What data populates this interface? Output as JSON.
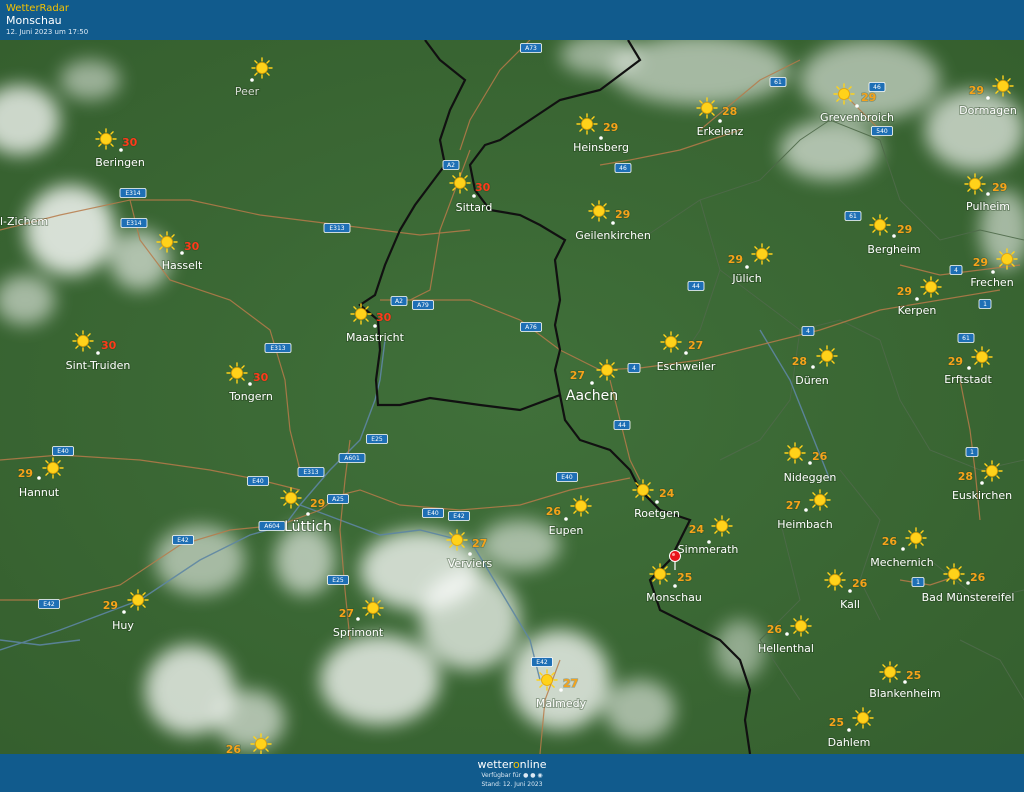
{
  "header": {
    "app_title": "WetterRadar",
    "location": "Monschau",
    "timestamp": "12. Juni 2023 um 17:50"
  },
  "footer": {
    "brand_a": "wetter",
    "brand_o": "o",
    "brand_b": "nline",
    "available": "Verfügbar für",
    "stand": "Stand: 12. Juni 2023"
  },
  "colors": {
    "land": "#3d6b35",
    "header_bg": "#115b8d",
    "brand_accent": "#f5c300",
    "temp_orange": "#f5a21a",
    "temp_red": "#ff3a1a",
    "sun": "#ffd21a"
  },
  "marker": {
    "name": "Monschau",
    "icon": "location-pin-icon"
  },
  "cities": [
    {
      "name": "Peer",
      "temp": null,
      "dim": true,
      "icon": "sun-icon"
    },
    {
      "name": "Beringen",
      "temp": "30",
      "icon": "sun-icon"
    },
    {
      "name": "l-Zichem",
      "temp": null,
      "icon": null
    },
    {
      "name": "Hasselt",
      "temp": "30",
      "icon": "sun-icon"
    },
    {
      "name": "Sint-Truiden",
      "temp": "30",
      "icon": "sun-icon"
    },
    {
      "name": "Tongern",
      "temp": "30",
      "icon": "sun-icon"
    },
    {
      "name": "Hannut",
      "temp": "29",
      "icon": "sun-icon"
    },
    {
      "name": "Huy",
      "temp": "29",
      "icon": "sun-icon"
    },
    {
      "name": "Lüttich",
      "temp": "29",
      "big": true,
      "icon": "sun-icon"
    },
    {
      "name": "Sprimont",
      "temp": "27",
      "icon": "sun-icon"
    },
    {
      "name": "Verviers",
      "temp": "27",
      "icon": "sun-icon"
    },
    {
      "name": "Eupen",
      "temp": "26",
      "icon": "sun-icon"
    },
    {
      "name": "Malmedy",
      "temp": "27",
      "icon": "sun-icon"
    },
    {
      "name": "Maastricht",
      "temp": "30",
      "icon": "sun-icon"
    },
    {
      "name": "Sittard",
      "temp": "30",
      "icon": "sun-icon"
    },
    {
      "name": "Heinsberg",
      "temp": "29",
      "icon": "sun-icon"
    },
    {
      "name": "Geilenkirchen",
      "temp": "29",
      "icon": "sun-icon"
    },
    {
      "name": "Erkelenz",
      "temp": "28",
      "icon": "sun-icon"
    },
    {
      "name": "Aachen",
      "temp": "27",
      "big": true,
      "icon": "sun-icon"
    },
    {
      "name": "Eschweiler",
      "temp": "27",
      "icon": "sun-icon"
    },
    {
      "name": "Jülich",
      "temp": "29",
      "icon": "sun-icon"
    },
    {
      "name": "Roetgen",
      "temp": "24",
      "icon": "sun-icon"
    },
    {
      "name": "Simmerath",
      "temp": "24",
      "icon": "sun-icon"
    },
    {
      "name": "Monschau",
      "temp": "25",
      "icon": "sun-icon"
    },
    {
      "name": "Düren",
      "temp": "28",
      "icon": "sun-icon"
    },
    {
      "name": "Nideggen",
      "temp": "26",
      "icon": "sun-icon"
    },
    {
      "name": "Heimbach",
      "temp": "27",
      "icon": "sun-icon"
    },
    {
      "name": "Hellenthal",
      "temp": "26",
      "icon": "sun-icon"
    },
    {
      "name": "Kall",
      "temp": "26",
      "icon": "sun-icon"
    },
    {
      "name": "Mechernich",
      "temp": "26",
      "icon": "sun-icon"
    },
    {
      "name": "Blankenheim",
      "temp": "25",
      "icon": "sun-icon"
    },
    {
      "name": "Dahlem",
      "temp": "25",
      "icon": "sun-icon"
    },
    {
      "name": "Bad Münstereifel",
      "temp": "26",
      "icon": "sun-icon"
    },
    {
      "name": "Euskirchen",
      "temp": "28",
      "icon": "sun-icon"
    },
    {
      "name": "Erftstadt",
      "temp": "29",
      "icon": "sun-icon"
    },
    {
      "name": "Kerpen",
      "temp": "29",
      "icon": "sun-icon"
    },
    {
      "name": "Frechen",
      "temp": "29",
      "icon": "sun-icon"
    },
    {
      "name": "Bergheim",
      "temp": "29",
      "icon": "sun-icon"
    },
    {
      "name": "Pulheim",
      "temp": "29",
      "icon": "sun-icon"
    },
    {
      "name": "Grevenbroich",
      "temp": "29",
      "icon": "sun-icon"
    },
    {
      "name": "Dormagen",
      "temp": "29",
      "icon": "sun-icon"
    },
    {
      "name": "",
      "temp": "26",
      "icon": "sun-icon"
    }
  ],
  "roads": [
    "A73",
    "61",
    "46",
    "540",
    "A2",
    "46",
    "E314",
    "E313",
    "E314",
    "61",
    "4",
    "44",
    "1",
    "A2",
    "A79",
    "A76",
    "4",
    "4",
    "61",
    "E313",
    "E25",
    "44",
    "1",
    "E40",
    "E40",
    "A601",
    "E313",
    "A25",
    "E40",
    "A604",
    "E42",
    "E42",
    "E40",
    "E25",
    "1",
    "E42",
    "E42"
  ]
}
